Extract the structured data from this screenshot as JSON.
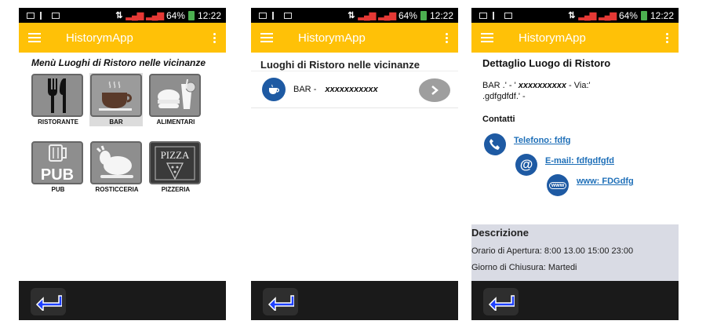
{
  "status_bar": {
    "battery": "64%",
    "time": "12:22"
  },
  "app_title": "HistorymApp",
  "screen1": {
    "heading": "Menù Luoghi di Ristoro nelle vicinanze",
    "tiles": [
      {
        "label": "RISTORANTE",
        "icon": "cutlery-icon"
      },
      {
        "label": "BAR",
        "icon": "coffee-cup-icon",
        "selected": true
      },
      {
        "label": "ALIMENTARI",
        "icon": "burger-drink-icon"
      },
      {
        "label": "PUB",
        "icon": "beer-mug-icon"
      },
      {
        "label": "ROSTICCERIA",
        "icon": "roast-chicken-icon"
      },
      {
        "label": "PIZZERIA",
        "icon": "pizza-icon"
      }
    ]
  },
  "screen2": {
    "heading": "Luoghi di Ristoro nelle vicinanze",
    "item": {
      "type": "BAR",
      "separator": "-",
      "name": "xxxxxxxxxxx"
    }
  },
  "screen3": {
    "heading": "Dettaglio Luogo di Ristoro",
    "address_prefix": "BAR .' - '",
    "address_name": "xxxxxxxxxx",
    "address_suffix": "- Via:'",
    "address_line2": ".gdfgdfdf.' -",
    "contacts_heading": "Contatti",
    "phone": "Telefono: fdfg",
    "email": "E-mail: fdfgdfgfd",
    "web": "www: FDGdfg",
    "description_heading": "Descrizione",
    "opening_hours": "Orario di Apertura: 8:00 13.00  15:00 23:00",
    "closing_day": "Giorno di Chiusura: Martedi"
  },
  "colors": {
    "appbar": "#ffc107",
    "accent_blue": "#1e5aa3",
    "link": "#1e6fb8"
  }
}
